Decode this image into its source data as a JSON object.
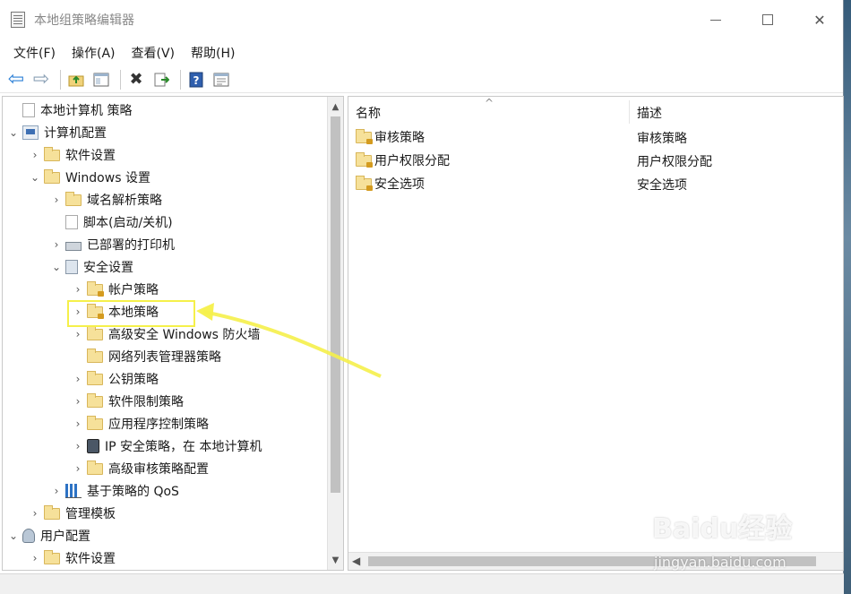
{
  "window": {
    "title": "本地组策略编辑器",
    "controls": {
      "minimize": "—",
      "maximize": "☐",
      "close": "✕"
    }
  },
  "menu": [
    "文件(F)",
    "操作(A)",
    "查看(V)",
    "帮助(H)"
  ],
  "toolbar": {
    "icons": [
      "back-arrow-icon",
      "forward-arrow-icon",
      "up-folder-icon",
      "show-hide-tree-icon",
      "delete-icon",
      "export-list-icon",
      "help-icon",
      "properties-icon"
    ]
  },
  "tree": {
    "items": [
      {
        "label": "本地计算机 策略",
        "depth": 0,
        "expander": "",
        "icon": "policy-icon"
      },
      {
        "label": "计算机配置",
        "depth": 1,
        "expander": "v",
        "icon": "computer-icon"
      },
      {
        "label": "软件设置",
        "depth": 2,
        "expander": ">",
        "icon": "folder-icon"
      },
      {
        "label": "Windows 设置",
        "depth": 2,
        "expander": "v",
        "icon": "folder-icon"
      },
      {
        "label": "域名解析策略",
        "depth": 3,
        "expander": ">",
        "icon": "folder-icon"
      },
      {
        "label": "脚本(启动/关机)",
        "depth": 3,
        "expander": "",
        "icon": "script-icon"
      },
      {
        "label": "已部署的打印机",
        "depth": 3,
        "expander": ">",
        "icon": "printer-icon"
      },
      {
        "label": "安全设置",
        "depth": 3,
        "expander": "v",
        "icon": "security-icon"
      },
      {
        "label": "帐户策略",
        "depth": 4,
        "expander": ">",
        "icon": "locked-folder-icon"
      },
      {
        "label": "本地策略",
        "depth": 4,
        "expander": ">",
        "icon": "locked-folder-icon"
      },
      {
        "label": "高级安全 Windows 防火墙",
        "depth": 4,
        "expander": ">",
        "icon": "folder-icon"
      },
      {
        "label": "网络列表管理器策略",
        "depth": 4,
        "expander": "",
        "icon": "folder-icon"
      },
      {
        "label": "公钥策略",
        "depth": 4,
        "expander": ">",
        "icon": "folder-icon"
      },
      {
        "label": "软件限制策略",
        "depth": 4,
        "expander": ">",
        "icon": "folder-icon"
      },
      {
        "label": "应用程序控制策略",
        "depth": 4,
        "expander": ">",
        "icon": "folder-icon"
      },
      {
        "label": "IP 安全策略，在 本地计算机",
        "depth": 4,
        "expander": ">",
        "icon": "network-computer-icon"
      },
      {
        "label": "高级审核策略配置",
        "depth": 4,
        "expander": ">",
        "icon": "folder-icon"
      },
      {
        "label": "基于策略的 QoS",
        "depth": 3,
        "expander": ">",
        "icon": "bar-chart-icon"
      },
      {
        "label": "管理模板",
        "depth": 2,
        "expander": ">",
        "icon": "folder-icon"
      },
      {
        "label": "用户配置",
        "depth": 1,
        "expander": "v",
        "icon": "user-icon"
      },
      {
        "label": "软件设置",
        "depth": 2,
        "expander": ">",
        "icon": "folder-icon"
      }
    ]
  },
  "list": {
    "columns": [
      "名称",
      "描述"
    ],
    "rows": [
      {
        "name": "审核策略",
        "desc": "审核策略"
      },
      {
        "name": "用户权限分配",
        "desc": "用户权限分配"
      },
      {
        "name": "安全选项",
        "desc": "安全选项"
      }
    ]
  },
  "annotation": {
    "highlight_color": "#f5f04a"
  },
  "watermark": {
    "brand": "Baidu经验",
    "url": "jingyan.baidu.com"
  }
}
